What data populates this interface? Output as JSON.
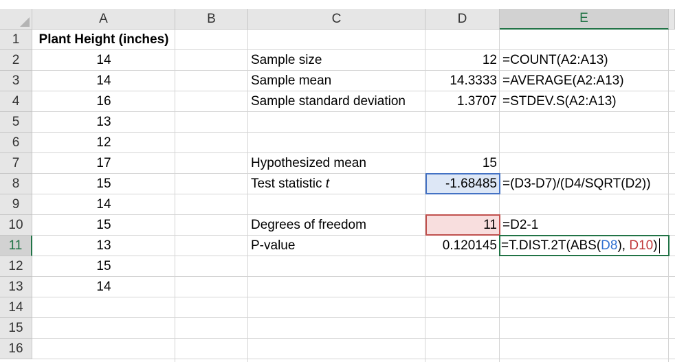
{
  "columns": [
    "A",
    "B",
    "C",
    "D",
    "E"
  ],
  "rows": [
    "1",
    "2",
    "3",
    "4",
    "5",
    "6",
    "7",
    "8",
    "9",
    "10",
    "11",
    "12",
    "13",
    "14",
    "15",
    "16"
  ],
  "cells": {
    "A1": "Plant Height (inches)",
    "A2": "14",
    "A3": "14",
    "A4": "16",
    "A5": "13",
    "A6": "12",
    "A7": "17",
    "A8": "15",
    "A9": "14",
    "A10": "15",
    "A11": "13",
    "A12": "15",
    "A13": "14",
    "C2": "Sample size",
    "C3": "Sample mean",
    "C4": "Sample standard deviation",
    "C7": "Hypothesized mean",
    "C8": "Test statistic ",
    "C8_italic": "t",
    "C10": "Degrees of freedom",
    "C11": "P-value",
    "D2": "12",
    "D3": "14.3333",
    "D4": "1.3707",
    "D7": "15",
    "D8": "-1.68485",
    "D10": "11",
    "D11": "0.120145",
    "E2": "=COUNT(A2:A13)",
    "E3": "=AVERAGE(A2:A13)",
    "E4": "=STDEV.S(A2:A13)",
    "E8": "=(D3-D7)/(D4/SQRT(D2))",
    "E10": "=D2-1",
    "E11_parts": {
      "p1": "=T.DIST.2T(ABS(",
      "ref1": "D8",
      "p2": "), ",
      "ref2": "D10",
      "p3": ")"
    }
  },
  "selected_column": "E",
  "selected_row": "11",
  "colors": {
    "header_bg": "#e6e6e6",
    "selected_header_bg": "#d2d2d2",
    "active_green": "#217346",
    "ref_blue": "#4472c4",
    "ref_red": "#c0504d"
  }
}
